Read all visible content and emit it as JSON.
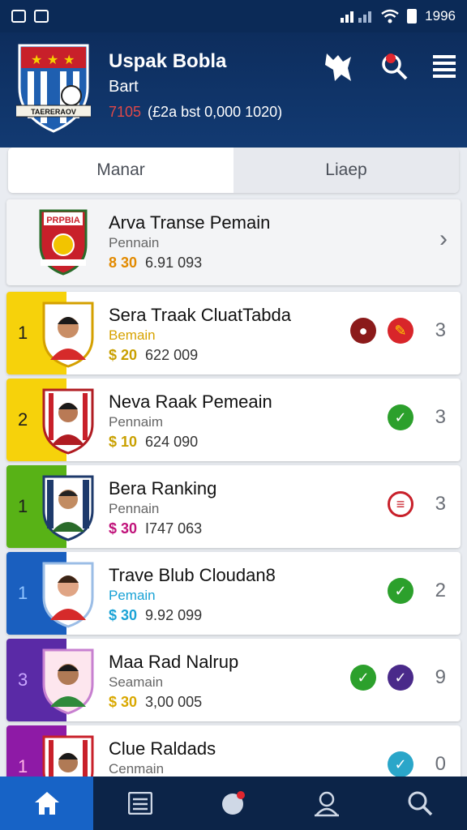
{
  "status_bar": {
    "time": "1996"
  },
  "header": {
    "club_name": "Uspak Bobla",
    "subtitle": "Bart",
    "stats_accent": "7105",
    "stats_text": "(£2a bst  0,000  1020)",
    "crest_text": "TAERERAOV"
  },
  "tabs": [
    {
      "label": "Manar"
    },
    {
      "label": "Liaep"
    }
  ],
  "rows": [
    {
      "rank": "",
      "name": "Arva Transe Pemain",
      "role": "Pennain",
      "price_accent": "8 30",
      "price_rest": "6.91 093",
      "right": "›",
      "strip_color": "#f3f4f6",
      "role_color": "#6a6a6a",
      "price_color": "#e28a00"
    },
    {
      "rank": "1",
      "name": "Sera  Traak CluatTabda",
      "role": "Bemain",
      "price_accent": "$ 20",
      "price_rest": "622 009",
      "right": "3",
      "strip_color": "#f6d20b",
      "role_color": "#d7a300",
      "price_color": "#c9a000"
    },
    {
      "rank": "2",
      "name": "Neva Raak Pemeain",
      "role": "Pennaim",
      "price_accent": "$ 10",
      "price_rest": "624 090",
      "right": "3",
      "strip_color": "#f6d20b",
      "role_color": "#6a6a6a",
      "price_color": "#c9a000"
    },
    {
      "rank": "1",
      "name": "Bera Ranking",
      "role": "Pennain",
      "price_accent": "$ 30",
      "price_rest": "I747 063",
      "right": "3",
      "strip_color": "#58b216",
      "role_color": "#6a6a6a",
      "price_color": "#c0127a"
    },
    {
      "rank": "1",
      "name": "Trave Blub Cloudan8",
      "role": "Pemain",
      "price_accent": "$ 30",
      "price_rest": "9.92 099",
      "right": "2",
      "strip_color": "#1a5fbf",
      "role_color": "#1aa3d6",
      "price_color": "#1aa3d6"
    },
    {
      "rank": "3",
      "name": "Maa Rad  Nalrup",
      "role": "Seamain",
      "price_accent": "$ 30",
      "price_rest": "3,00 005",
      "right": "9",
      "strip_color": "#5a2aa6",
      "role_color": "#6a6a6a",
      "price_color": "#d9a800"
    },
    {
      "rank": "1",
      "name": "Clue Raldads",
      "role": "Cenmain",
      "price_accent": "",
      "price_rest": "",
      "right": "0",
      "strip_color": "#8e1aa6",
      "role_color": "#6a6a6a",
      "price_color": "#6a6a6a"
    }
  ],
  "bottom_nav": [
    {
      "icon": "home-icon"
    },
    {
      "icon": "list-icon"
    },
    {
      "icon": "ball-icon"
    },
    {
      "icon": "user-icon"
    },
    {
      "icon": "search-icon"
    }
  ]
}
